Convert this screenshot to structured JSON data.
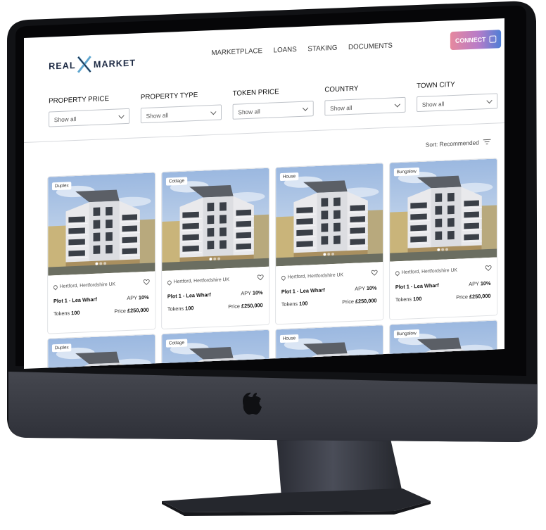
{
  "app": {
    "logo_left": "REAL",
    "logo_right": "MARKET"
  },
  "nav": {
    "items": [
      "MARKETPLACE",
      "LOANS",
      "STAKING",
      "DOCUMENTS"
    ],
    "connect_label": "CONNECT"
  },
  "filters": [
    {
      "label": "PROPERTY PRICE",
      "value": "Show all"
    },
    {
      "label": "PROPERTY TYPE",
      "value": "Show all"
    },
    {
      "label": "TOKEN PRICE",
      "value": "Show all"
    },
    {
      "label": "COUNTRY",
      "value": "Show all"
    },
    {
      "label": "TOWN CITY",
      "value": "Show all"
    }
  ],
  "sort_label": "Sort: Recommended",
  "listings": [
    {
      "type": "Duplex",
      "location": "Hertford, Hertfordshire UK",
      "name": "Plot 1 - Lea Wharf",
      "apy_label": "APY",
      "apy": "10%",
      "tokens_label": "Tokens",
      "tokens": "100",
      "price_label": "Price",
      "price": "£250,000"
    },
    {
      "type": "Cottage",
      "location": "Hertford, Hertfordshire UK",
      "name": "Plot 1 - Lea Wharf",
      "apy_label": "APY",
      "apy": "10%",
      "tokens_label": "Tokens",
      "tokens": "100",
      "price_label": "Price",
      "price": "£250,000"
    },
    {
      "type": "House",
      "location": "Hertford, Hertfordshire UK",
      "name": "Plot 1 - Lea Wharf",
      "apy_label": "APY",
      "apy": "10%",
      "tokens_label": "Tokens",
      "tokens": "100",
      "price_label": "Price",
      "price": "£250,000"
    },
    {
      "type": "Bungalow",
      "location": "Hertford, Hertfordshire UK",
      "name": "Plot 1 - Lea Wharf",
      "apy_label": "APY",
      "apy": "10%",
      "tokens_label": "Tokens",
      "tokens": "100",
      "price_label": "Price",
      "price": "£250,000"
    },
    {
      "type": "Duplex"
    },
    {
      "type": "Cottage"
    },
    {
      "type": "House"
    },
    {
      "type": "Bungalow"
    }
  ],
  "colors": {
    "accent_gradient_start": "#e6889e",
    "accent_gradient_end": "#4f7fd6",
    "logo_navy": "#1d2a44",
    "logo_x": "#5fa6cf",
    "bezel": "#0b0b0d",
    "body": "#3b3d47"
  },
  "icons": [
    "apple-logo-icon",
    "heart-icon",
    "location-pin-icon",
    "chevron-down-icon",
    "sort-icon",
    "connect-icon"
  ]
}
